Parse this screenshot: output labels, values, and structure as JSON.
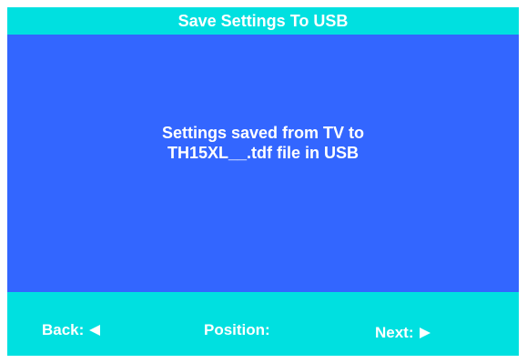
{
  "header": {
    "title": "Save Settings To USB"
  },
  "main": {
    "message_line1": "Settings saved from TV to",
    "message_line2": "TH15XL__.tdf file in USB"
  },
  "footer": {
    "back_label": "Back:",
    "position_label": "Position:",
    "next_label": "Next:"
  },
  "colors": {
    "bar": "#00e0e0",
    "panel": "#3366ff",
    "text": "#ffffff"
  },
  "icons": {
    "back": "arrow-left-icon",
    "next": "arrow-right-icon"
  }
}
